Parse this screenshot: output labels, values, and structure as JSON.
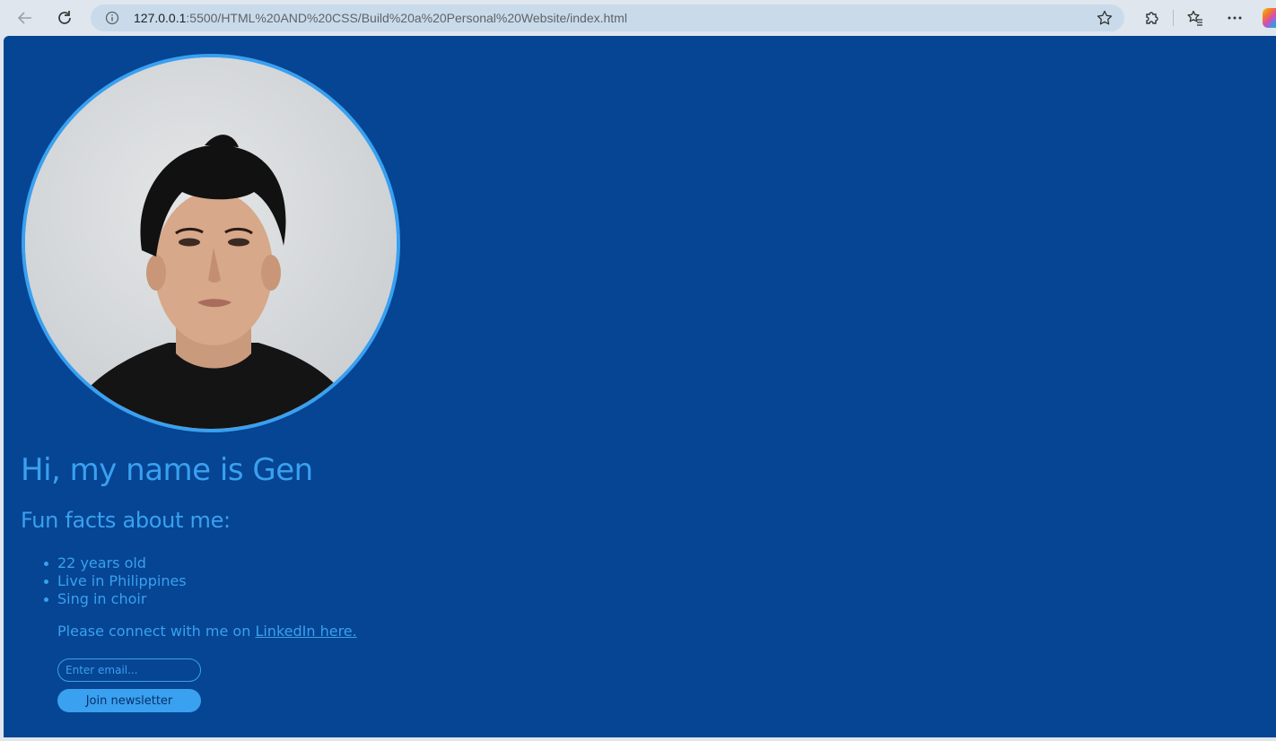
{
  "browser": {
    "url_host": "127.0.0.1",
    "url_rest": ":5500/HTML%20AND%20CSS/Build%20a%20Personal%20Website/index.html",
    "icons": [
      "back-arrow-icon",
      "reload-icon",
      "info-icon",
      "star-icon",
      "extensions-icon",
      "favorites-icon",
      "more-icon",
      "copilot-icon"
    ]
  },
  "page": {
    "title": "Hi, my name is Gen",
    "subtitle": "Fun facts about me:",
    "facts": [
      "22 years old",
      "Live in Philippines",
      "Sing in choir"
    ],
    "connect_text": "Please connect with me on ",
    "connect_link": "LinkedIn here.",
    "email_placeholder": "Enter email...",
    "join_label": "Join newsletter"
  },
  "colors": {
    "page_background": "#054593",
    "accent": "#3aa0f0"
  }
}
